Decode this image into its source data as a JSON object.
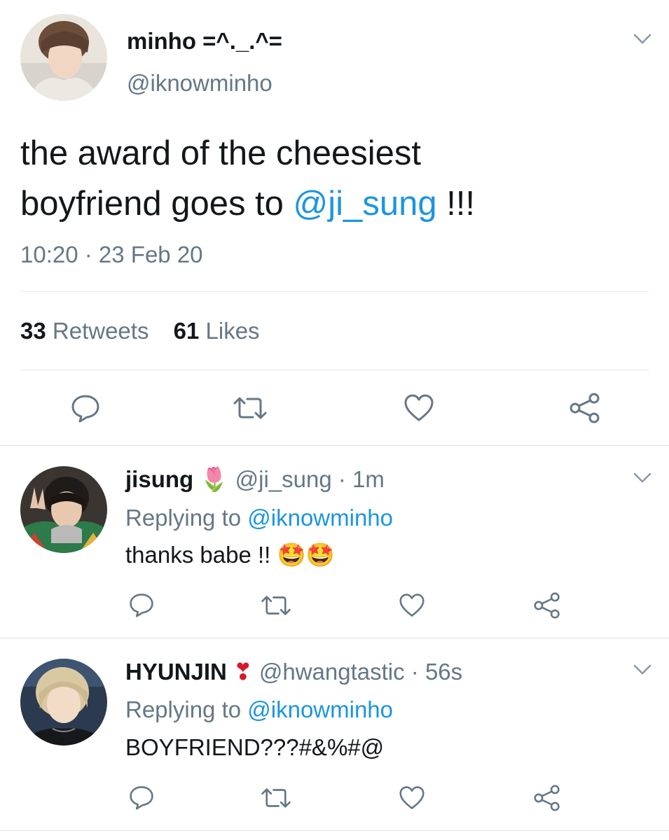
{
  "main_tweet": {
    "display_name": "minho =^._.^=",
    "handle": "@iknowminho",
    "text_part1": "the award of the cheesiest",
    "text_part2": "boyfriend goes to ",
    "mention": "@ji_sung",
    "text_suffix": " !!!",
    "timestamp": "10:20 · 23 Feb 20",
    "retweets_count": "33",
    "retweets_label": "Retweets",
    "likes_count": "61",
    "likes_label": "Likes"
  },
  "replies": [
    {
      "display_name": "jisung",
      "emoji": "🌷",
      "handle": "@ji_sung",
      "time": "· 1m",
      "replying_prefix": "Replying to ",
      "replying_to": "@iknowminho",
      "text": "thanks babe !!",
      "text_emoji": "🤩🤩"
    },
    {
      "display_name": "HYUNJIN",
      "emoji": "❣",
      "handle": "@hwangtastic",
      "time": "· 56s",
      "replying_prefix": "Replying to ",
      "replying_to": "@iknowminho",
      "text": "BOYFRIEND???#&%#@",
      "text_emoji": ""
    }
  ],
  "colors": {
    "link_blue": "#1b95e0",
    "grey_text": "#657786",
    "divider": "#e1e8ed",
    "icon_grey": "#657786"
  },
  "icons": [
    "chevron-down-icon",
    "reply-icon",
    "retweet-icon",
    "heart-icon",
    "share-icon"
  ]
}
